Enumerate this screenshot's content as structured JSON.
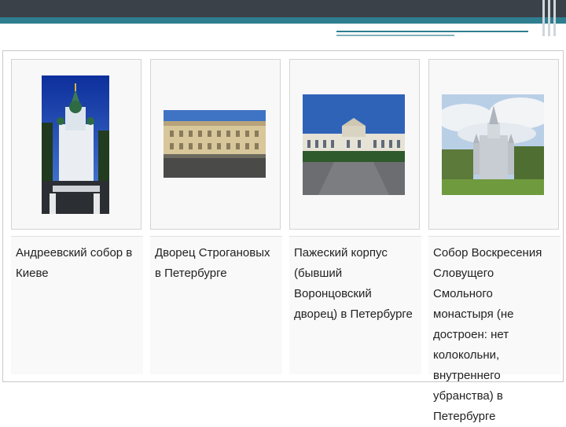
{
  "gallery": {
    "items": [
      {
        "caption": "Андреевский собор в Киеве",
        "image": "st-andrews-church-kyiv-photo"
      },
      {
        "caption": "Дворец Строгановых в Петербурге",
        "image": "stroganov-palace-photo"
      },
      {
        "caption": "Пажеский корпус (бывший Воронцовский дворец) в Петербурге",
        "image": "page-corps-vorontsov-palace-photo"
      },
      {
        "caption": "Собор Воскресения Словущего Смольного монастыря (не достроен: нет колокольни, внутреннего убранства) в Петербурге",
        "image": "smolny-cathedral-photo"
      }
    ]
  }
}
